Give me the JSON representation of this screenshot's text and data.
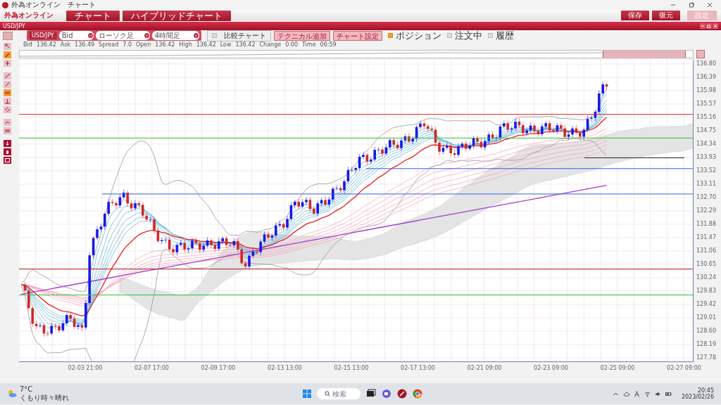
{
  "window": {
    "title": "外為オンライン　チャート"
  },
  "toolbar": {
    "logo": "外為オンライン",
    "tabs": [
      {
        "label": "チャート",
        "selected": true
      },
      {
        "label": "ハイブリッドチャート",
        "selected": true
      }
    ],
    "actions": [
      {
        "label": "保存",
        "kind": "dark"
      },
      {
        "label": "復元",
        "kind": "dark"
      },
      {
        "label": "設定",
        "kind": "light"
      }
    ]
  },
  "panel": {
    "title": "USD/JPY"
  },
  "controls": {
    "symbol": "USD/JPY",
    "selects": [
      "Bid",
      "ローソク足",
      "4時間足"
    ],
    "compare": {
      "label": "比較チャート",
      "checked": false
    },
    "buttons": [
      "テクニカル追加",
      "チャート設定"
    ],
    "checkboxes": [
      {
        "label": "ポジション",
        "checked": true
      },
      {
        "label": "注文中",
        "checked": false
      },
      {
        "label": "履歴",
        "checked": false
      }
    ]
  },
  "quote": [
    {
      "label": "Bid",
      "value": "136.42"
    },
    {
      "label": "Ask",
      "value": "136.49"
    },
    {
      "label": "Spread",
      "value": "7.0"
    },
    {
      "label": "Open",
      "value": "136.42"
    },
    {
      "label": "High",
      "value": "136.42"
    },
    {
      "label": "Low",
      "value": "136.42"
    },
    {
      "label": "Change",
      "value": "0.00"
    },
    {
      "label": "Time",
      "value": "06:59"
    }
  ],
  "chart": {
    "price_labels": [
      "136.80",
      "136.39",
      "135.98",
      "135.57",
      "135.16",
      "134.75",
      "134.34",
      "133.93",
      "133.52",
      "133.11",
      "132.70",
      "132.29",
      "131.88",
      "131.47",
      "131.06",
      "130.65",
      "130.24",
      "129.83",
      "129.42",
      "129.01",
      "128.60",
      "128.19",
      "127.78"
    ],
    "time_labels": [
      "02-03 21:00",
      "02-07 17:00",
      "02-09 17:00",
      "02-13 13:00",
      "02-15 13:00",
      "02-17 13:00",
      "02-21 09:00",
      "02-23 09:00",
      "02-25 09:00",
      "02-27 09:00"
    ]
  },
  "taskbar": {
    "temperature": "7°C",
    "weather": "くもり時々晴れ",
    "search": {
      "placeholder": "検索"
    },
    "time": "20:45",
    "date": "2023/02/26"
  }
}
